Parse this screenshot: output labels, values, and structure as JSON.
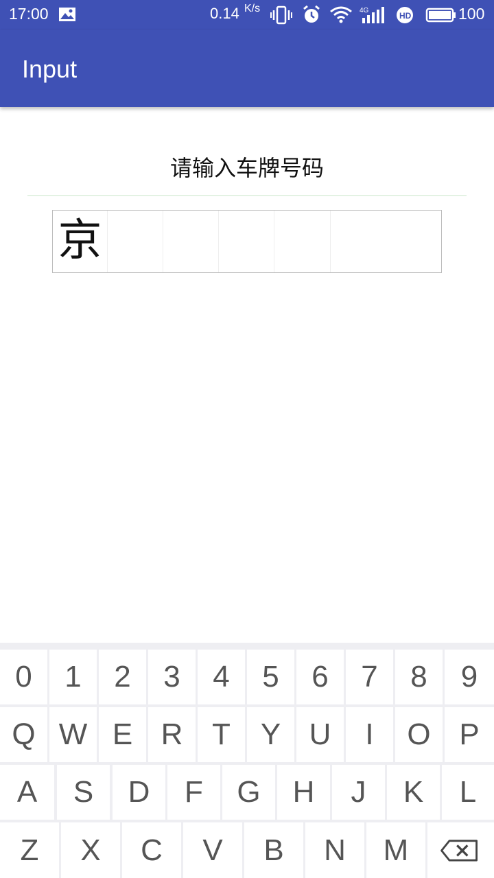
{
  "status_bar": {
    "time": "17:00",
    "net_speed": "0.14",
    "net_speed_unit": "K/s",
    "battery": "100",
    "icons": [
      "gallery-icon",
      "vibrate-icon",
      "alarm-icon",
      "wifi-icon",
      "signal-4g-icon",
      "hd-icon",
      "battery-icon"
    ]
  },
  "app_bar": {
    "title": "Input"
  },
  "form": {
    "prompt": "请输入车牌号码",
    "plate_cells": [
      "京",
      "",
      "",
      "",
      "",
      ""
    ]
  },
  "keyboard": {
    "rows": [
      [
        "0",
        "1",
        "2",
        "3",
        "4",
        "5",
        "6",
        "7",
        "8",
        "9"
      ],
      [
        "Q",
        "W",
        "E",
        "R",
        "T",
        "Y",
        "U",
        "I",
        "O",
        "P"
      ],
      [
        "A",
        "S",
        "D",
        "F",
        "G",
        "H",
        "J",
        "K",
        "L"
      ],
      [
        "Z",
        "X",
        "C",
        "V",
        "B",
        "N",
        "M"
      ]
    ],
    "backspace_icon": "backspace-icon"
  },
  "colors": {
    "primary": "#3f51b5",
    "keyboard_bg": "#eeeef2",
    "key_text": "#555555"
  }
}
